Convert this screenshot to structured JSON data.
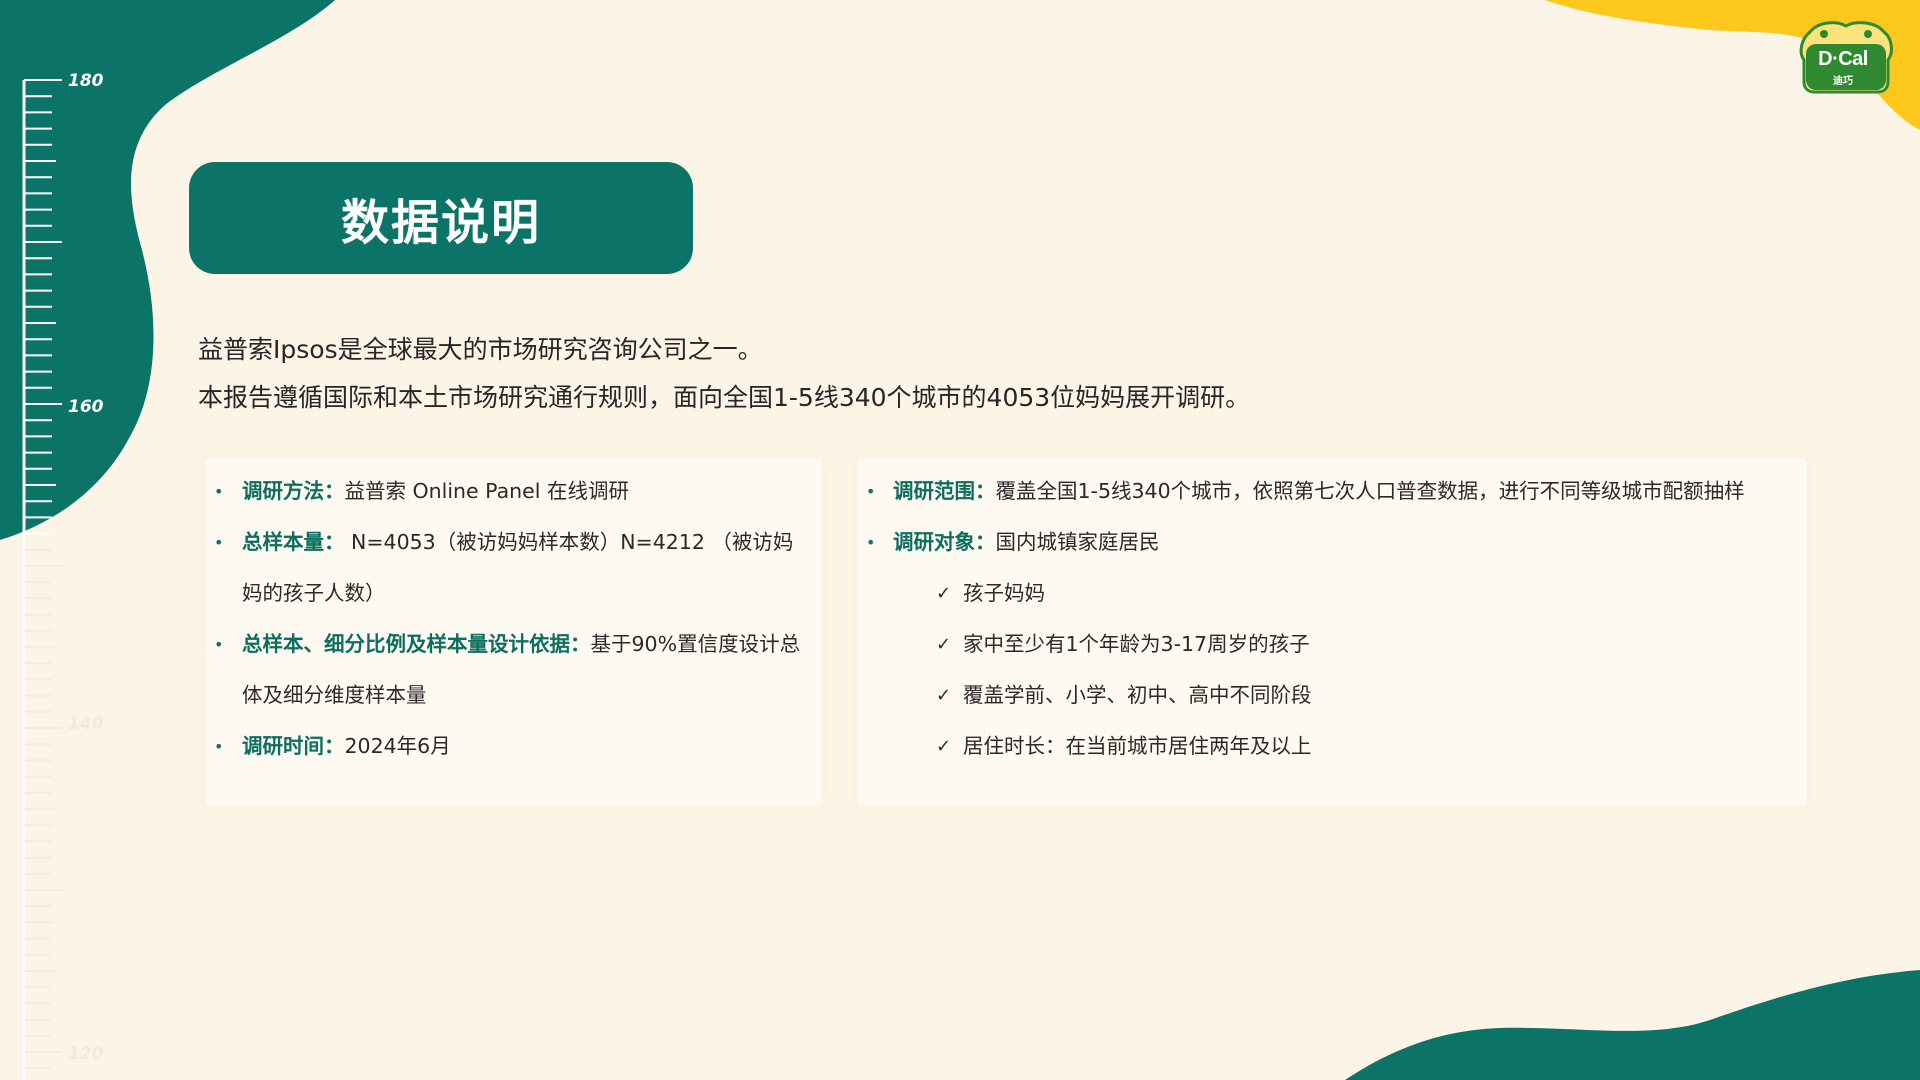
{
  "ruler": {
    "labels": [
      "180",
      "160",
      "140",
      "120"
    ]
  },
  "logo": {
    "text": "D·Cal",
    "subtext": "迪巧"
  },
  "title": "数据说明",
  "intro": {
    "line1": "益普索Ipsos是全球最大的市场研究咨询公司之一。",
    "line2": "本报告遵循国际和本土市场研究通行规则，面向全国1-5线340个城市的4053位妈妈展开调研。"
  },
  "left_card": {
    "items": [
      {
        "label": "调研方法",
        "sep": "：",
        "text": "益普索 Online Panel 在线调研"
      },
      {
        "label": "总样本量",
        "sep": "：",
        "text": " N=4053（被访妈妈样本数）N=4212 （被访妈妈的孩子人数）"
      },
      {
        "label": "总样本、细分比例及样本量设计依据",
        "sep": "：",
        "text": "基于90%置信度设计总体及细分维度样本量"
      },
      {
        "label": "调研时间",
        "sep": "：",
        "text": "2024年6月"
      }
    ]
  },
  "right_card": {
    "items": [
      {
        "label": "调研范围",
        "sep": "：",
        "text": "覆盖全国1-5线340个城市，依照第七次人口普查数据，进行不同等级城市配额抽样"
      },
      {
        "label": "调研对象",
        "sep": "：",
        "text": "国内城镇家庭居民"
      }
    ],
    "checks": [
      "孩子妈妈",
      "家中至少有1个年龄为3-17周岁的孩子",
      "覆盖学前、小学、初中、高中不同阶段",
      "居住时长：在当前城市居住两年及以上"
    ]
  },
  "colors": {
    "background": "#fcf4e6",
    "teal": "#0b7466",
    "yellow": "#fbc81b",
    "logo_green": "#2f8a2f"
  }
}
